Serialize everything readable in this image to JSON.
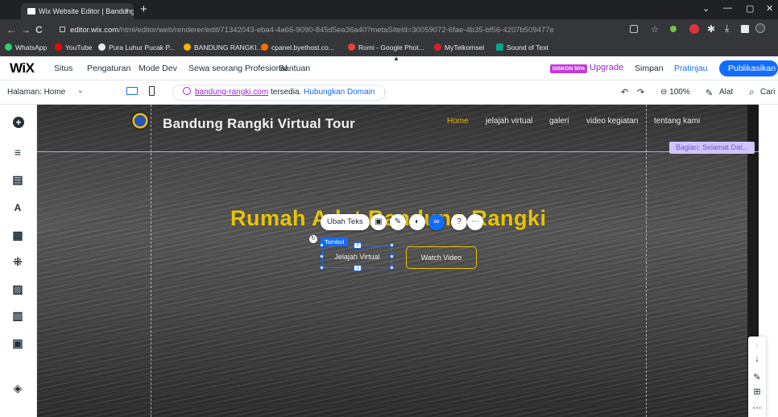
{
  "browser": {
    "tab_title": "Wix Website Editor | Bandung Ra",
    "tab_close": "×",
    "new_tab": "+",
    "window_controls": [
      "⌄",
      "—",
      "▢",
      "✕"
    ],
    "nav": {
      "back": "←",
      "forward": "→",
      "reload": "C"
    },
    "url_host": "editor.wix.com",
    "url_path": "/html/editor/web/renderer/edit/71342043-eba4-4a66-9090-845d5ea36a40?metaSiteId=30059072-6fae-4b35-bf56-4207b509477e",
    "bookmarks": [
      "WhatsApp",
      "YouTube",
      "Pura Luhur Pucak P...",
      "BANDUNG RANGKI...",
      "cpanel.byethost.co...",
      "Romi - Google Phot...",
      "MyTelkomsel",
      "Sound of Text"
    ],
    "bookmark_colors": [
      "#25d366",
      "#ff0000",
      "#e8eaed",
      "#f4b400",
      "#ff6d00",
      "#ea4335",
      "#d61f2c",
      "#00a884"
    ]
  },
  "wix": {
    "logo": "WiX",
    "menu": [
      "Situs",
      "Pengaturan",
      "Mode Dev",
      "Sewa seorang Profesional",
      "Bantuan"
    ],
    "promo_badge": "DISKON 50%",
    "upgrade": "Upgrade",
    "save": "Simpan",
    "preview": "Pratinjau",
    "publish": "Publikasikan",
    "page_selector": "Halaman: Home",
    "page_selector_arrow": "⌄",
    "domain_name": "bandung-rangki.com",
    "domain_available": "tersedia.",
    "domain_connect": "Hubungkan Domain",
    "domain_close": "×",
    "undo": "↶",
    "redo": "↷",
    "zoom": "⊖ 100%",
    "tools": "Alat",
    "search": "Cari",
    "search_icon": "⌕",
    "tools_icon": "✎"
  },
  "site": {
    "title": "Bandung Rangki Virtual Tour",
    "nav": [
      {
        "label": "Home",
        "active": true
      },
      {
        "label": "jelajah virtual",
        "active": false
      },
      {
        "label": "galeri",
        "active": false
      },
      {
        "label": "video kegiatan",
        "active": false
      },
      {
        "label": "tentang kami",
        "active": false
      }
    ],
    "section_badge": "Bagian: Selamat Dat...",
    "hero_title": "Rumah Adat Bandung Rangki",
    "button_primary": "Jelajah Virtual",
    "button_secondary": "Watch Video",
    "selected_tag": "Tombol",
    "edit_text_chip": "Ubah Teks"
  },
  "colors": {
    "accent": "#116dff",
    "upgrade": "#9a27d5",
    "hero_yellow": "#e9c400",
    "section_purple": "#b8a8f0"
  },
  "left_panel_icons": [
    "add-icon",
    "menus-icon",
    "pages-icon",
    "theme-icon",
    "apps-icon",
    "business-icon",
    "media-icon",
    "cms-icon",
    "portfolio-icon",
    "layers-icon"
  ],
  "right_tools": [
    "↑",
    "↓",
    "✎",
    "⊞",
    "⋯"
  ]
}
